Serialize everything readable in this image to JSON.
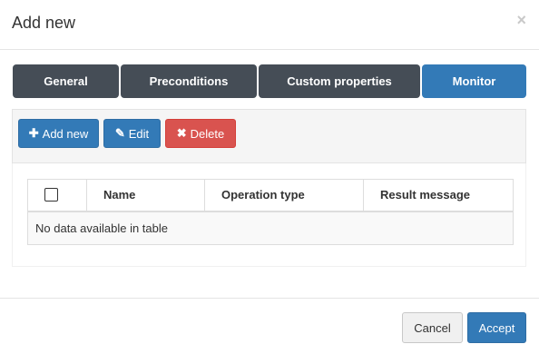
{
  "dialog": {
    "title": "Add new",
    "close_glyph": "×"
  },
  "tabs": [
    {
      "label": "General",
      "active": false
    },
    {
      "label": "Preconditions",
      "active": false
    },
    {
      "label": "Custom properties",
      "active": false
    },
    {
      "label": "Monitor",
      "active": true
    }
  ],
  "toolbar": {
    "add_label": "Add new",
    "add_icon": "plus-icon",
    "edit_label": "Edit",
    "edit_icon": "pencil-icon",
    "delete_label": "Delete",
    "delete_icon": "x-icon"
  },
  "table": {
    "columns": [
      "Name",
      "Operation type",
      "Result message"
    ],
    "empty_message": "No data available in table"
  },
  "footer": {
    "cancel_label": "Cancel",
    "accept_label": "Accept"
  },
  "colors": {
    "primary": "#337ab7",
    "danger": "#d9534f",
    "tab_dark": "#454d56"
  }
}
